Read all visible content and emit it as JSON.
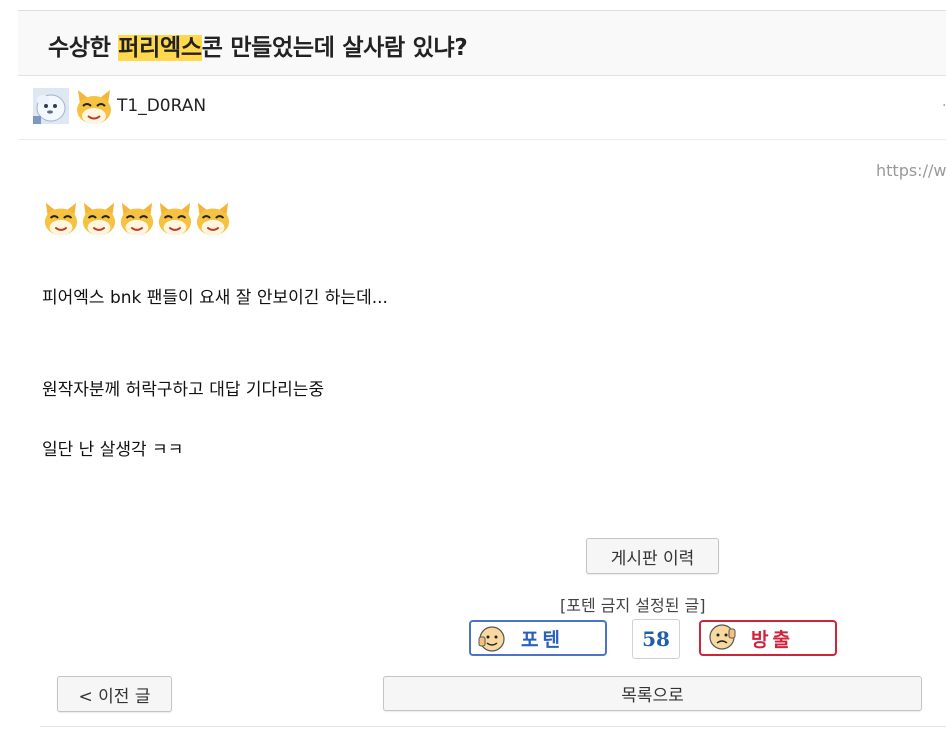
{
  "post": {
    "title_prefix": "수상한 ",
    "title_highlight": "퍼리엑스",
    "title_suffix": "콘 만들었는데 살사람 있냐?",
    "author": "T1_D0RAN",
    "url_partial": "https://w",
    "paragraphs": [
      "피어엑스 bnk 팬들이 요새 잘 안보이긴 하는데...",
      "원작자분께 허락구하고 대답 기다리는중",
      "일단 난 살생각 ㅋㅋ"
    ]
  },
  "actions": {
    "board_history_label": "게시판 이력",
    "notice": "[포텐 금지 설정된 글]",
    "upvote_label": "포텐",
    "upvote_count": "58",
    "downvote_label": "방출",
    "prev_label": "< 이전 글",
    "list_label": "목록으로"
  },
  "colors": {
    "highlight": "#ffd84d",
    "upvote": "#4a73c9",
    "downvote": "#d0233a",
    "count": "#1f5fa8"
  },
  "icons": {
    "avatar_1": "snow-creature-avatar-icon",
    "avatar_2": "fox-emoticon-icon",
    "emoticon": "fox-emoticon-icon",
    "upvote": "thumbs-up-face-icon",
    "downvote": "thumbs-down-face-icon"
  }
}
